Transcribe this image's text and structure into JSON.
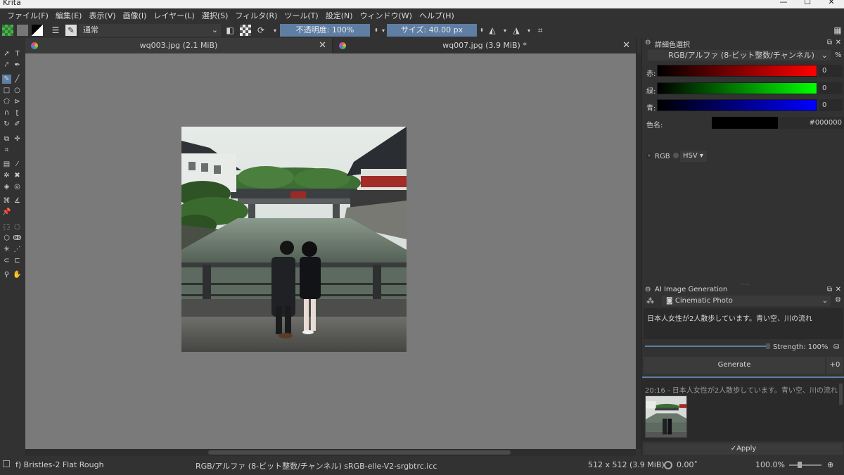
{
  "window": {
    "title": "Krita",
    "controls": [
      "—",
      "☐",
      "✕"
    ]
  },
  "menu": [
    "ファイル(F)",
    "編集(E)",
    "表示(V)",
    "画像(I)",
    "レイヤー(L)",
    "選択(S)",
    "フィルタ(R)",
    "ツール(T)",
    "設定(N)",
    "ウィンドウ(W)",
    "ヘルプ(H)"
  ],
  "toolbar": {
    "blend_mode": "通常",
    "opacity": "不透明度: 100%",
    "opacity_fraction": 1.0,
    "size": "サイズ: 40.00 px"
  },
  "tabs": [
    {
      "label": "wq003.jpg (2.1 MiB)",
      "close": "✕"
    },
    {
      "label": "wq007.jpg (3.9 MiB) *",
      "close": "✕"
    }
  ],
  "status": {
    "brush": "f) Bristles-2 Flat Rough",
    "colorspace": "RGB/アルファ (8-ビット整数/チャンネル)  sRGB-elle-V2-srgbtrc.icc",
    "dims": "512 x 512 (3.9 MiB)",
    "rotation": "0.00˚",
    "zoom": "100.0%"
  },
  "color_panel": {
    "title": "詳細色選択",
    "model": "RGB/アルファ (8-ビット整数/チャンネル)",
    "percent": "%",
    "channels": [
      {
        "label": "赤:",
        "value": "0",
        "color": "#ff0000"
      },
      {
        "label": "緑:",
        "value": "0",
        "color": "#00ff00"
      },
      {
        "label": "青:",
        "value": "0",
        "color": "#0000ff"
      }
    ],
    "color_name_label": "色名:",
    "hex": "#000000",
    "rgb_label": "RGB",
    "hsv_label": "HSV"
  },
  "ai_panel": {
    "title": "AI Image Generation",
    "style": "Cinematic Photo",
    "prompt": "日本人女性が2人散歩しています。青い空、川の流れ",
    "strength": "Strength: 100%",
    "strength_fraction": 1.0,
    "generate": "Generate",
    "plus": "+0",
    "history_entry": "20:16 - 日本人女性が2人散歩しています。青い空、川の流れ",
    "apply": "Apply"
  }
}
